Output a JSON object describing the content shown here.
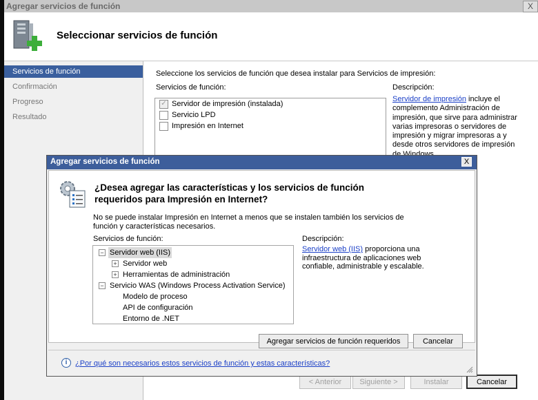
{
  "main": {
    "window_title": "Agregar servicios de función",
    "close_glyph": "X",
    "header_title": "Seleccionar servicios de función",
    "nav": [
      {
        "label": "Servicios de función",
        "active": true
      },
      {
        "label": "Confirmación",
        "active": false
      },
      {
        "label": "Progreso",
        "active": false
      },
      {
        "label": "Resultado",
        "active": false
      }
    ],
    "instruction": "Seleccione los servicios de función que desea instalar para Servicios de impresión:",
    "services_label": "Servicios de función:",
    "services": [
      {
        "label": "Servidor de impresión (instalada)",
        "checked": true
      },
      {
        "label": "Servicio LPD",
        "checked": false
      },
      {
        "label": "Impresión en Internet",
        "checked": false
      }
    ],
    "description_label": "Descripción:",
    "description_link": "Servidor de impresión",
    "description_rest": " incluye el complemento Administración de impresión, que sirve para administrar varias impresoras o servidores de impresión y migrar impresoras a y desde otros servidores de impresión de Windows.",
    "buttons": {
      "back": "< Anterior",
      "next": "Siguiente >",
      "install": "Instalar",
      "cancel": "Cancelar"
    }
  },
  "dialog": {
    "title": "Agregar servicios de función",
    "close_glyph": "X",
    "question": "¿Desea agregar las características y los servicios de función requeridos para Impresión en Internet?",
    "explanation": "No se puede instalar Impresión en Internet a menos que se instalen también los servicios de función y características necesarios.",
    "services_label": "Servicios de función:",
    "tree": [
      {
        "label": "Servidor web (IIS)",
        "level": 0,
        "expander": "−",
        "selected": true
      },
      {
        "label": "Servidor web",
        "level": 1,
        "expander": "+",
        "selected": false
      },
      {
        "label": "Herramientas de administración",
        "level": 1,
        "expander": "+",
        "selected": false
      },
      {
        "label": "Servicio WAS (Windows Process Activation Service)",
        "level": 0,
        "expander": "−",
        "selected": false
      },
      {
        "label": "Modelo de proceso",
        "level": 1,
        "expander": "",
        "selected": false
      },
      {
        "label": "API de configuración",
        "level": 1,
        "expander": "",
        "selected": false
      },
      {
        "label": "Entorno de .NET",
        "level": 1,
        "expander": "",
        "selected": false
      }
    ],
    "description_label": "Descripción:",
    "description_link": "Servidor web (IIS)",
    "description_rest": " proporciona una infraestructura de aplicaciones web confiable, administrable y escalable.",
    "add_button": "Agregar servicios de función requeridos",
    "cancel_button": "Cancelar",
    "help_link": "¿Por qué son necesarios estos servicios de función y estas características?",
    "help_icon_glyph": "i"
  }
}
